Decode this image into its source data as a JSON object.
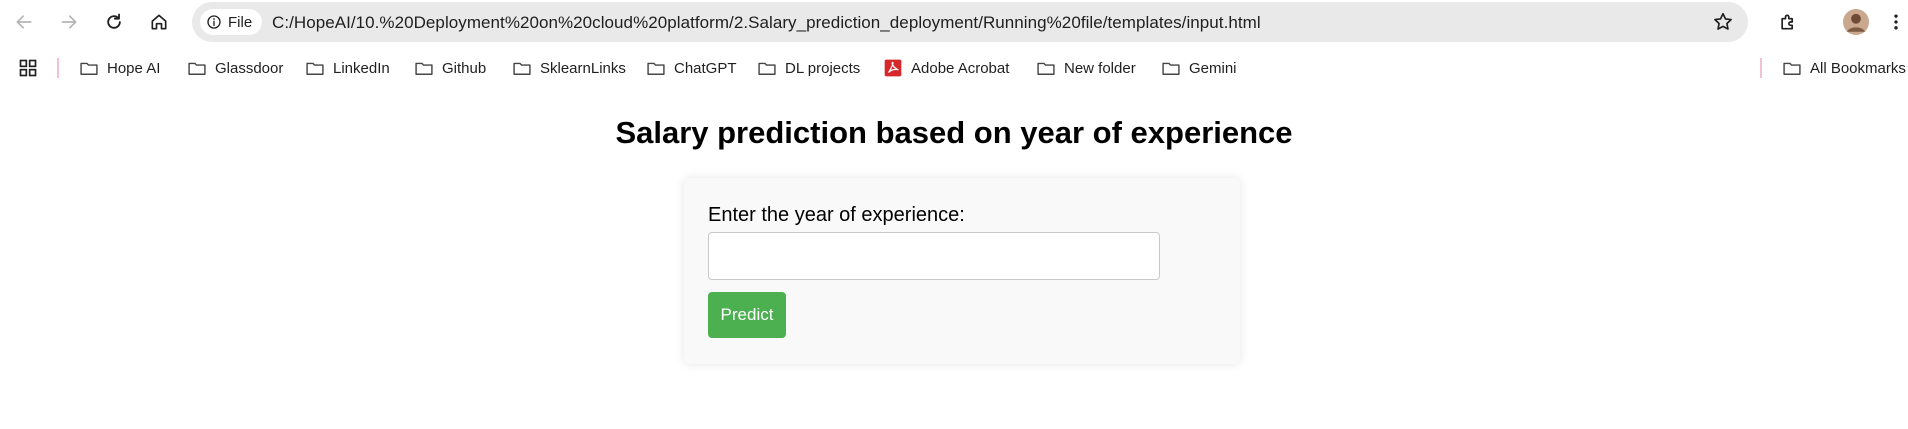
{
  "browser": {
    "omnibox": {
      "chip_label": "File",
      "url": "C:/HopeAI/10.%20Deployment%20on%20cloud%20platform/2.Salary_prediction_deployment/Running%20file/templates/input.html"
    },
    "bookmarks": [
      {
        "label": "Hope AI",
        "icon": "folder-icon"
      },
      {
        "label": "Glassdoor",
        "icon": "folder-icon"
      },
      {
        "label": "LinkedIn",
        "icon": "folder-icon"
      },
      {
        "label": "Github",
        "icon": "folder-icon"
      },
      {
        "label": "SklearnLinks",
        "icon": "folder-icon"
      },
      {
        "label": "ChatGPT",
        "icon": "folder-icon"
      },
      {
        "label": "DL projects",
        "icon": "folder-icon"
      },
      {
        "label": "Adobe Acrobat",
        "icon": "adobe-acrobat-icon"
      },
      {
        "label": "New folder",
        "icon": "folder-icon"
      },
      {
        "label": "Gemini",
        "icon": "folder-icon"
      }
    ],
    "all_bookmarks_label": "All Bookmarks",
    "colors": {
      "acrobat_red": "#d6282b",
      "separator_pink": "#f2c2cf"
    }
  },
  "page": {
    "title": "Salary prediction based on year of experience",
    "form": {
      "label": "Enter the year of experience:",
      "input_value": "",
      "button_label": "Predict",
      "button_color": "#4caf50"
    }
  }
}
